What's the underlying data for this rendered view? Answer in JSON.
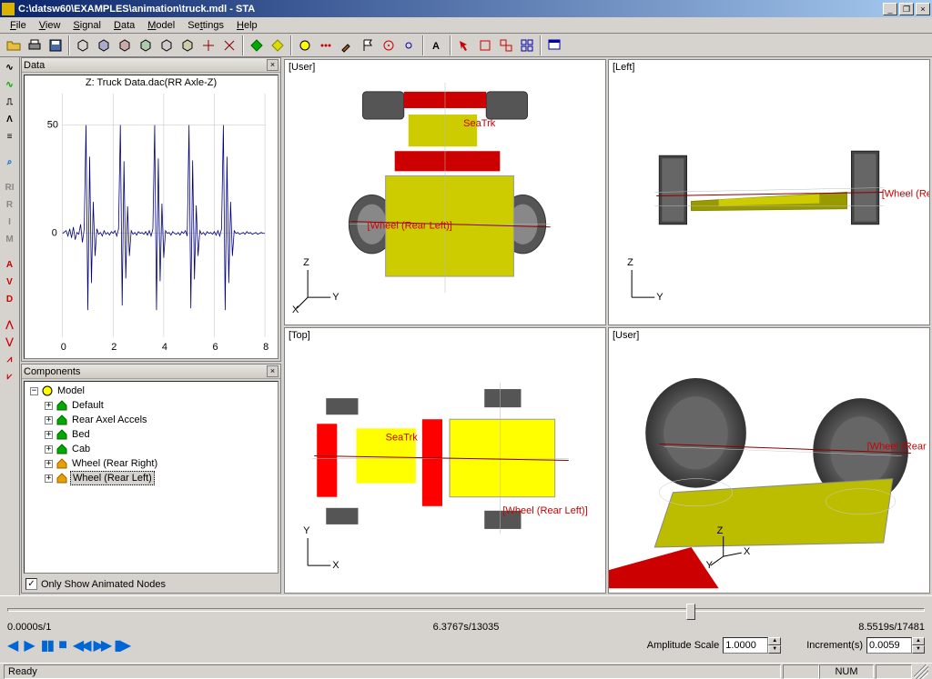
{
  "titlebar": {
    "title": "C:\\datsw60\\EXAMPLES\\animation\\truck.mdl - STA"
  },
  "menu": {
    "file": "File",
    "view": "View",
    "signal": "Signal",
    "data": "Data",
    "model": "Model",
    "settings": "Settings",
    "help": "Help"
  },
  "left_tools": [
    "∿",
    "∿",
    "⎍",
    "Λ",
    "Ξ",
    "⌕",
    "RI",
    "R",
    "I",
    "M",
    "A",
    "V",
    "D",
    "⋀",
    "⋁",
    "⋀",
    "⩒"
  ],
  "data_panel": {
    "title": "Data",
    "chart_title": "Z: Truck Data.dac(RR Axle-Z)"
  },
  "chart_data": {
    "type": "line",
    "title": "Z: Truck Data.dac(RR Axle-Z)",
    "xlabel": "",
    "ylabel": "",
    "xlim": [
      0,
      8
    ],
    "ylim": [
      -50,
      60
    ],
    "xticks": [
      0,
      2,
      4,
      6,
      8
    ],
    "yticks": [
      0,
      50
    ],
    "series": [
      {
        "name": "RR Axle-Z",
        "color": "#00007f"
      }
    ],
    "note": "dense vibration signal with ~5 impulse spikes around x≈1,2.5,4,5.5,7 peaking ≈50"
  },
  "components_panel": {
    "title": "Components",
    "root": "Model",
    "items": [
      {
        "label": "Default",
        "icon": "home"
      },
      {
        "label": "Rear Axel Accels",
        "icon": "home"
      },
      {
        "label": "Bed",
        "icon": "home"
      },
      {
        "label": "Cab",
        "icon": "home"
      },
      {
        "label": "Wheel (Rear Right)",
        "icon": "home-y"
      },
      {
        "label": "Wheel (Rear Left)",
        "icon": "home-y",
        "selected": true
      }
    ],
    "checkbox_label": "Only Show Animated Nodes"
  },
  "views": {
    "tl": {
      "label": "[User]",
      "sel": "[Wheel (Rear Left)]",
      "tag": "SeaTrk",
      "axes": [
        "Z",
        "Y",
        "X"
      ]
    },
    "tr": {
      "label": "[Left]",
      "sel": "[Wheel (Rear Left)]",
      "axes": [
        "Z",
        "Y"
      ]
    },
    "bl": {
      "label": "[Top]",
      "sel": "[Wheel (Rear Left)]",
      "tag": "SeaTrk",
      "axes": [
        "Y",
        "X"
      ]
    },
    "br": {
      "label": "[User]",
      "sel": "[Wheel (Rear Left)]",
      "axes": [
        "Z",
        "Y",
        "X"
      ]
    }
  },
  "playback": {
    "start": "0.0000s/1",
    "current": "6.3767s/13035",
    "end": "8.5519s/17481",
    "amp_label": "Amplitude Scale",
    "amp_value": "1.0000",
    "inc_label": "Increment(s)",
    "inc_value": "0.0059"
  },
  "status": {
    "ready": "Ready",
    "num": "NUM"
  }
}
